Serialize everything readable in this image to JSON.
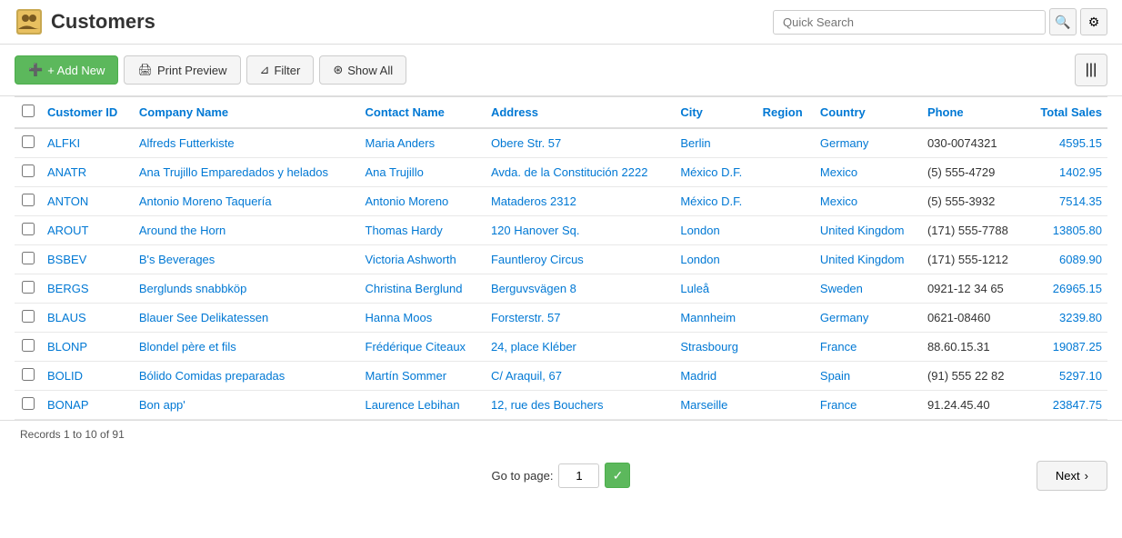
{
  "header": {
    "title": "Customers",
    "icon_alt": "customers-icon",
    "search_placeholder": "Quick Search"
  },
  "toolbar": {
    "add_new_label": "+ Add New",
    "print_preview_label": "Print Preview",
    "filter_label": "Filter",
    "show_all_label": "Show All",
    "column_chooser_icon": "|||"
  },
  "table": {
    "columns": [
      {
        "key": "checkbox",
        "label": ""
      },
      {
        "key": "customer_id",
        "label": "Customer ID"
      },
      {
        "key": "company_name",
        "label": "Company Name"
      },
      {
        "key": "contact_name",
        "label": "Contact Name"
      },
      {
        "key": "address",
        "label": "Address"
      },
      {
        "key": "city",
        "label": "City"
      },
      {
        "key": "region",
        "label": "Region"
      },
      {
        "key": "country",
        "label": "Country"
      },
      {
        "key": "phone",
        "label": "Phone"
      },
      {
        "key": "total_sales",
        "label": "Total Sales"
      }
    ],
    "rows": [
      {
        "customer_id": "ALFKI",
        "company_name": "Alfreds Futterkiste",
        "contact_name": "Maria Anders",
        "address": "Obere Str. 57",
        "city": "Berlin",
        "region": "",
        "country": "Germany",
        "phone": "030-0074321",
        "total_sales": "4595.15"
      },
      {
        "customer_id": "ANATR",
        "company_name": "Ana Trujillo Emparedados y helados",
        "contact_name": "Ana Trujillo",
        "address": "Avda. de la Constitución 2222",
        "city": "México D.F.",
        "region": "",
        "country": "Mexico",
        "phone": "(5) 555-4729",
        "total_sales": "1402.95"
      },
      {
        "customer_id": "ANTON",
        "company_name": "Antonio Moreno Taquería",
        "contact_name": "Antonio Moreno",
        "address": "Mataderos 2312",
        "city": "México D.F.",
        "region": "",
        "country": "Mexico",
        "phone": "(5) 555-3932",
        "total_sales": "7514.35"
      },
      {
        "customer_id": "AROUT",
        "company_name": "Around the Horn",
        "contact_name": "Thomas Hardy",
        "address": "120 Hanover Sq.",
        "city": "London",
        "region": "",
        "country": "United Kingdom",
        "phone": "(171) 555-7788",
        "total_sales": "13805.80"
      },
      {
        "customer_id": "BSBEV",
        "company_name": "B's Beverages",
        "contact_name": "Victoria Ashworth",
        "address": "Fauntleroy Circus",
        "city": "London",
        "region": "",
        "country": "United Kingdom",
        "phone": "(171) 555-1212",
        "total_sales": "6089.90"
      },
      {
        "customer_id": "BERGS",
        "company_name": "Berglunds snabbköp",
        "contact_name": "Christina Berglund",
        "address": "Berguvsvägen 8",
        "city": "Luleå",
        "region": "",
        "country": "Sweden",
        "phone": "0921-12 34 65",
        "total_sales": "26965.15"
      },
      {
        "customer_id": "BLAUS",
        "company_name": "Blauer See Delikatessen",
        "contact_name": "Hanna Moos",
        "address": "Forsterstr. 57",
        "city": "Mannheim",
        "region": "",
        "country": "Germany",
        "phone": "0621-08460",
        "total_sales": "3239.80"
      },
      {
        "customer_id": "BLONP",
        "company_name": "Blondel père et fils",
        "contact_name": "Frédérique Citeaux",
        "address": "24, place Kléber",
        "city": "Strasbourg",
        "region": "",
        "country": "France",
        "phone": "88.60.15.31",
        "total_sales": "19087.25"
      },
      {
        "customer_id": "BOLID",
        "company_name": "Bólido Comidas preparadas",
        "contact_name": "Martín Sommer",
        "address": "C/ Araquil, 67",
        "city": "Madrid",
        "region": "",
        "country": "Spain",
        "phone": "(91) 555 22 82",
        "total_sales": "5297.10"
      },
      {
        "customer_id": "BONAP",
        "company_name": "Bon app'",
        "contact_name": "Laurence Lebihan",
        "address": "12, rue des Bouchers",
        "city": "Marseille",
        "region": "",
        "country": "France",
        "phone": "91.24.45.40",
        "total_sales": "23847.75"
      }
    ]
  },
  "status": {
    "records_text": "Records 1 to 10 of 91"
  },
  "pagination": {
    "goto_label": "Go to page:",
    "page_value": "1",
    "go_icon": "✓",
    "next_label": "Next",
    "next_icon": "›"
  }
}
